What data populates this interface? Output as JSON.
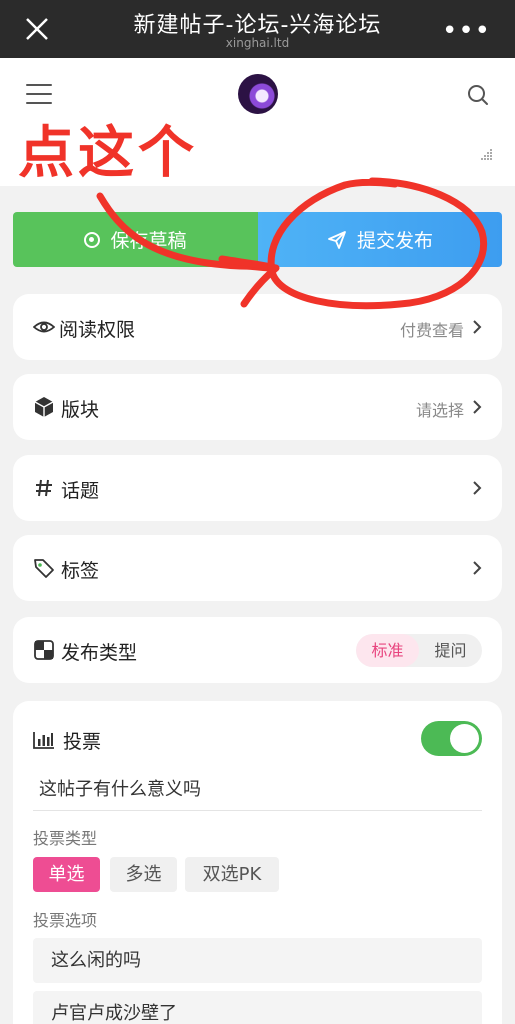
{
  "browser": {
    "title": "新建帖子-论坛-兴海论坛",
    "url": "xinghai.ltd",
    "close_icon": "close-icon",
    "more_label": "•••"
  },
  "header": {
    "menu_icon": "hamburger-icon",
    "logo": "site-logo",
    "search_icon": "search-icon"
  },
  "annotation": {
    "text": "点这个",
    "color": "#f03329"
  },
  "actions": {
    "save_label": "保存草稿",
    "submit_label": "提交发布",
    "save_color": "#58c35b",
    "submit_color": "#3d9df0"
  },
  "options": [
    {
      "icon": "eye-icon",
      "label": "阅读权限",
      "value": "付费查看"
    },
    {
      "icon": "cube-icon",
      "label": "版块",
      "value": "请选择"
    },
    {
      "icon": "hash-icon",
      "label": "话题",
      "value": ""
    },
    {
      "icon": "tag-icon",
      "label": "标签",
      "value": ""
    }
  ],
  "publish_type": {
    "label": "发布类型",
    "choices": [
      "标准",
      "提问"
    ],
    "selected": "标准"
  },
  "vote": {
    "label": "投票",
    "enabled": true,
    "question": "这帖子有什么意义吗",
    "type_label": "投票类型",
    "types": [
      "单选",
      "多选",
      "双选PK"
    ],
    "selected_type": "单选",
    "options_label": "投票选项",
    "options": [
      "这么闲的吗",
      "卢官卢成沙壁了"
    ]
  }
}
